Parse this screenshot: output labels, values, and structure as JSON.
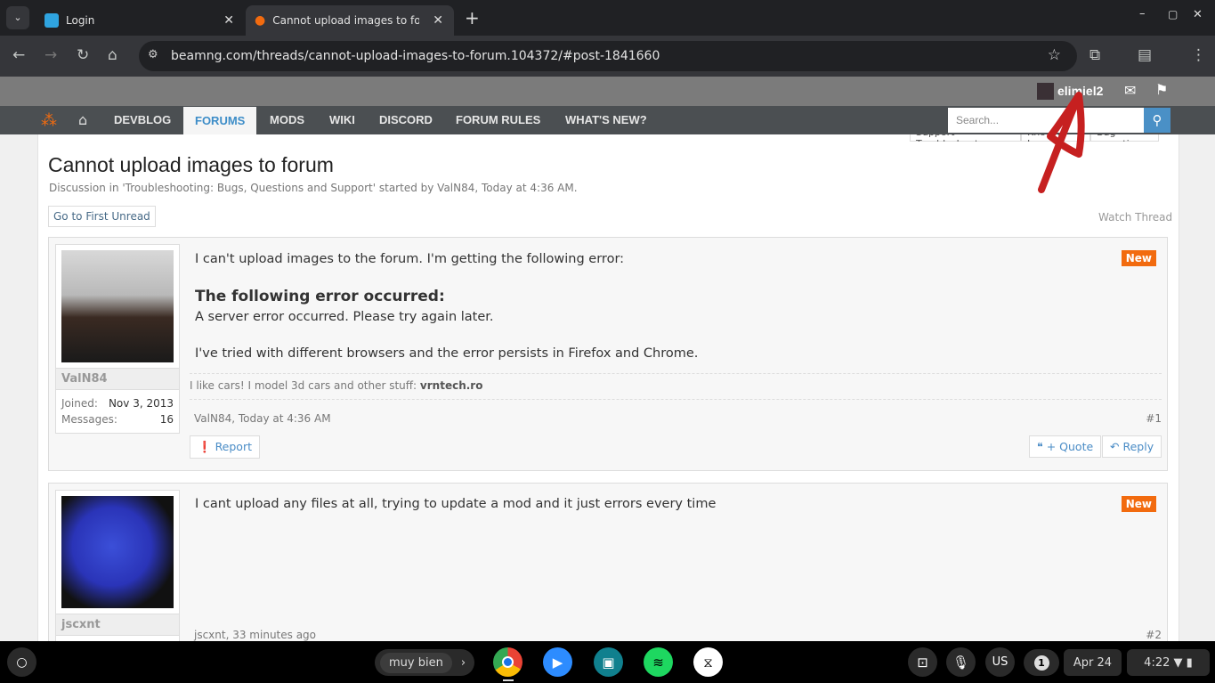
{
  "browser": {
    "tabs": [
      {
        "title": "Login"
      },
      {
        "title": "Cannot upload images to forum"
      }
    ],
    "url": "beamng.com/threads/cannot-upload-images-to-forum.104372/#post-1841660"
  },
  "site": {
    "username": "elimiel2",
    "nav": [
      "DEVBLOG",
      "FORUMS",
      "MODS",
      "WIKI",
      "DISCORD",
      "FORUM RULES",
      "WHAT'S NEW?"
    ],
    "search_placeholder": "Search...",
    "sublinks": [
      "Support Troubleshooter",
      "Known Issues",
      "Bug reporting"
    ]
  },
  "thread": {
    "title": "Cannot upload images to forum",
    "meta": "Discussion in 'Troubleshooting: Bugs, Questions and Support' started by ValN84, Today at 4:36 AM.",
    "first_unread": "Go to First Unread",
    "watch": "Watch Thread"
  },
  "posts": [
    {
      "user": "ValN84",
      "joined_label": "Joined:",
      "joined": "Nov 3, 2013",
      "messages_label": "Messages:",
      "messages": "16",
      "badge": "New",
      "line1": "I can't upload images to the forum. I'm getting the following error:",
      "error_title": "The following error occurred:",
      "error_msg": "A server error occurred. Please try again later.",
      "line2": "I've tried with different browsers and the error persists in Firefox and Chrome.",
      "signature": "I like cars! I model 3d cars and other stuff: ",
      "signature_link": "vrntech.ro",
      "byline": "ValN84, Today at 4:36 AM",
      "number": "#1",
      "report": "Report",
      "quote": "+ Quote",
      "reply": "Reply"
    },
    {
      "user": "jscxnt",
      "badge": "New",
      "line1": "I cant upload any files at all, trying to update a mod and it just errors every time",
      "byline": "jscxnt, 33 minutes ago",
      "number": "#2"
    }
  ],
  "taskbar": {
    "suggestion": "muy bien",
    "keyboard": "US",
    "notifications": "1",
    "date": "Apr 24",
    "time": "4:22"
  }
}
